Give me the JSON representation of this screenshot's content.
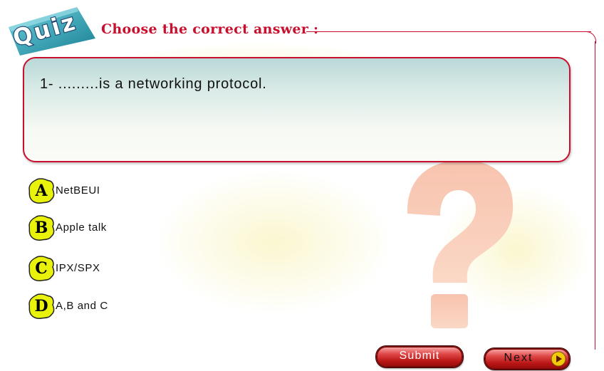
{
  "header": {
    "logo_text": "Quiz",
    "title": "Choose the correct answer :"
  },
  "question": {
    "text": "1- .........is a networking protocol."
  },
  "options": [
    {
      "letter": "A",
      "label": "NetBEUI"
    },
    {
      "letter": "B",
      "label": "Apple talk"
    },
    {
      "letter": "C",
      "label": "IPX/SPX"
    },
    {
      "letter": "D",
      "label": "A,B and C"
    }
  ],
  "buttons": {
    "submit_label": "Submit",
    "next_label": "Next"
  },
  "icons": {
    "badge": "yellow-splat-icon",
    "next": "play-arrow-icon",
    "background": "question-mark-icon"
  },
  "colors": {
    "accent": "#c8102e",
    "badge_fill": "#e9f20a",
    "button_red": "#c41a1a",
    "next_circle": "#f2c80a"
  }
}
